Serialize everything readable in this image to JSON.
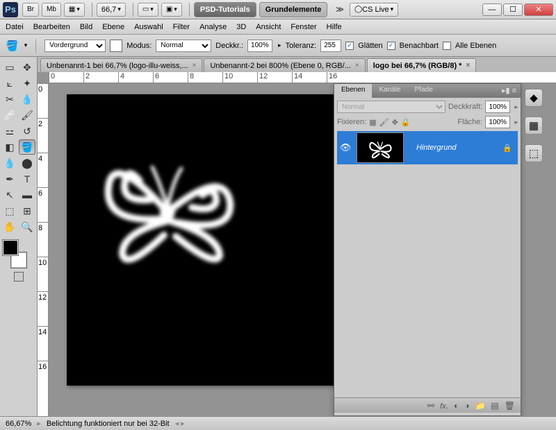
{
  "titlebar": {
    "br": "Br",
    "mb": "Mb",
    "zoom": "66,7",
    "workspace1": "PSD-Tutorials",
    "workspace2": "Grundelemente",
    "cslive": "CS Live"
  },
  "menu": [
    "Datei",
    "Bearbeiten",
    "Bild",
    "Ebene",
    "Auswahl",
    "Filter",
    "Analyse",
    "3D",
    "Ansicht",
    "Fenster",
    "Hilfe"
  ],
  "options": {
    "fill": "Vordergrund",
    "mode_label": "Modus:",
    "mode": "Normal",
    "opacity_label": "Deckkr.:",
    "opacity": "100%",
    "tolerance_label": "Toleranz:",
    "tolerance": "255",
    "antialias": "Glätten",
    "contiguous": "Benachbart",
    "alllayers": "Alle Ebenen"
  },
  "tabs": [
    "Unbenannt-1 bei 66,7% (logo-illu-weiss,...",
    "Unbenannt-2 bei 800% (Ebene 0, RGB/...",
    "logo bei 66,7% (RGB/8) *"
  ],
  "ruler_h": [
    "0",
    "2",
    "4",
    "6",
    "8",
    "10",
    "12",
    "14",
    "16"
  ],
  "ruler_v": [
    "0",
    "2",
    "4",
    "6",
    "8",
    "10",
    "12",
    "14",
    "16"
  ],
  "panel": {
    "tabs": [
      "Ebenen",
      "Kanäle",
      "Pfade"
    ],
    "blend": "Normal",
    "opacity_label": "Deckkraft:",
    "opacity": "100%",
    "lock_label": "Fixieren:",
    "fill_label": "Fläche:",
    "fill": "100%",
    "layer_name": "Hintergrund"
  },
  "status": {
    "zoom": "66,67%",
    "msg": "Belichtung funktioniert nur bei 32-Bit"
  }
}
